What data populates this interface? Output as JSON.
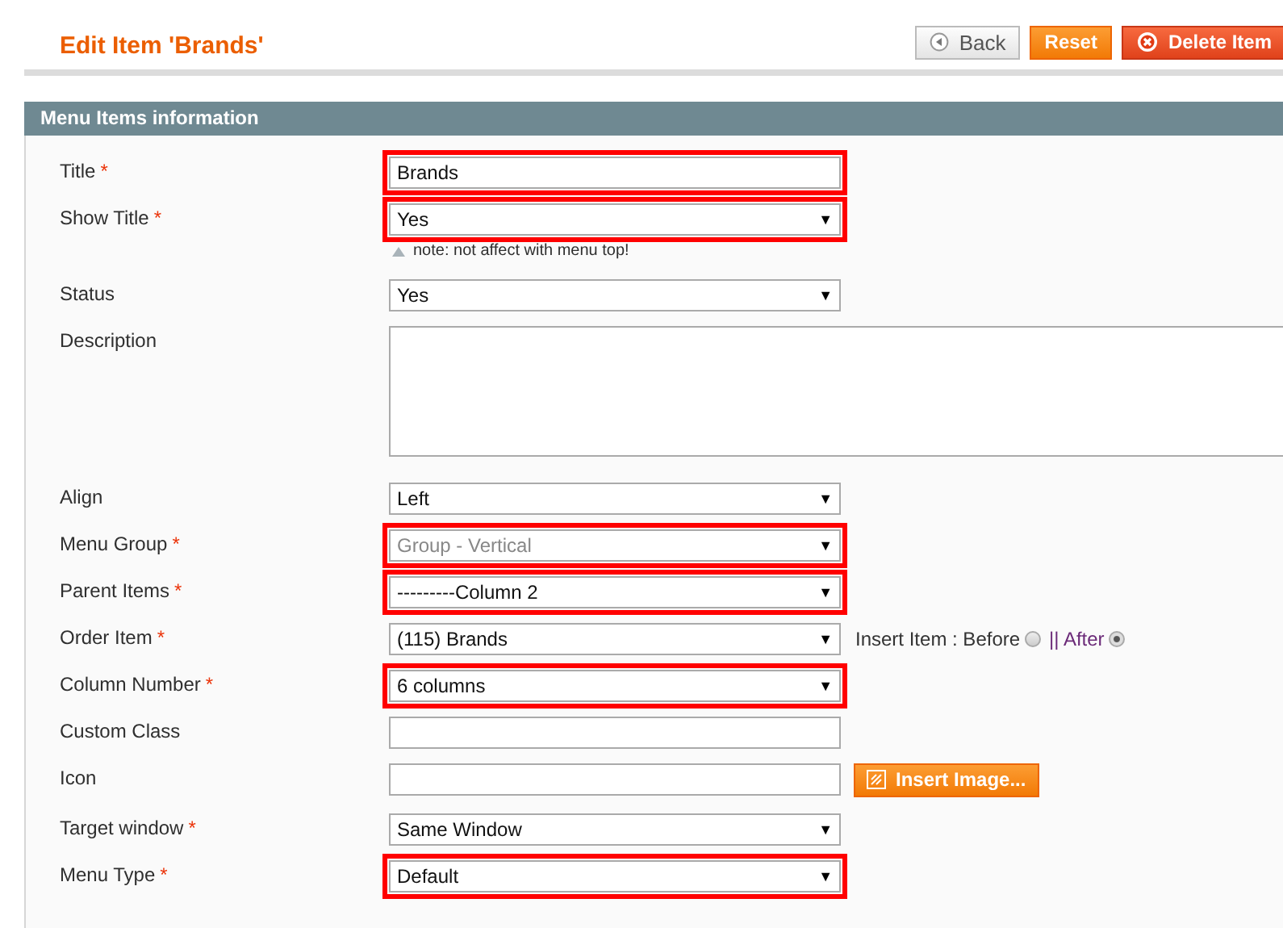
{
  "header": {
    "title": "Edit Item 'Brands'",
    "buttons": [
      {
        "kind": "back",
        "label": "Back"
      },
      {
        "kind": "primary",
        "label": "Reset"
      },
      {
        "kind": "delete",
        "label": "Delete Item"
      }
    ]
  },
  "section": {
    "title": "Menu Items information"
  },
  "fields": [
    {
      "kind": "text",
      "label": "Title",
      "required_mark": "*",
      "value": "Brands",
      "highlighted": true
    },
    {
      "kind": "select",
      "label": "Show Title",
      "required_mark": "*",
      "value": "Yes",
      "arrow": "▼",
      "highlighted": true,
      "note": "note: not affect with menu top!"
    },
    {
      "kind": "select",
      "label": "Status",
      "value": "Yes",
      "arrow": "▼",
      "highlighted": false
    },
    {
      "kind": "textarea",
      "label": "Description",
      "highlighted": false
    },
    {
      "kind": "select",
      "label": "Align",
      "value": "Left",
      "arrow": "▼",
      "highlighted": false
    },
    {
      "kind": "select",
      "label": "Menu Group",
      "required_mark": "*",
      "value": "Group - Vertical",
      "arrow": "▼",
      "highlighted": true,
      "disabled": true
    },
    {
      "kind": "select",
      "label": "Parent Items",
      "required_mark": "*",
      "value": "---------Column 2",
      "arrow": "▼",
      "highlighted": true
    },
    {
      "kind": "order",
      "label": "Order Item",
      "required_mark": "*",
      "value": "(115) Brands",
      "arrow": "▼",
      "highlighted": false,
      "insert_label": "Insert Item : Before",
      "separator": "|| After",
      "options": [
        {
          "selected": false
        },
        {
          "selected": true
        }
      ]
    },
    {
      "kind": "select",
      "label": "Column Number",
      "required_mark": "*",
      "value": "6 columns",
      "arrow": "▼",
      "highlighted": true
    },
    {
      "kind": "text",
      "label": "Custom Class",
      "highlighted": false
    },
    {
      "kind": "image",
      "label": "Icon",
      "highlighted": false,
      "button": "Insert Image..."
    },
    {
      "kind": "select",
      "label": "Target window",
      "required_mark": "*",
      "value": "Same Window",
      "arrow": "▼",
      "highlighted": false
    },
    {
      "kind": "select",
      "label": "Menu Type",
      "required_mark": "*",
      "value": "Default",
      "arrow": "▼",
      "highlighted": true
    }
  ]
}
